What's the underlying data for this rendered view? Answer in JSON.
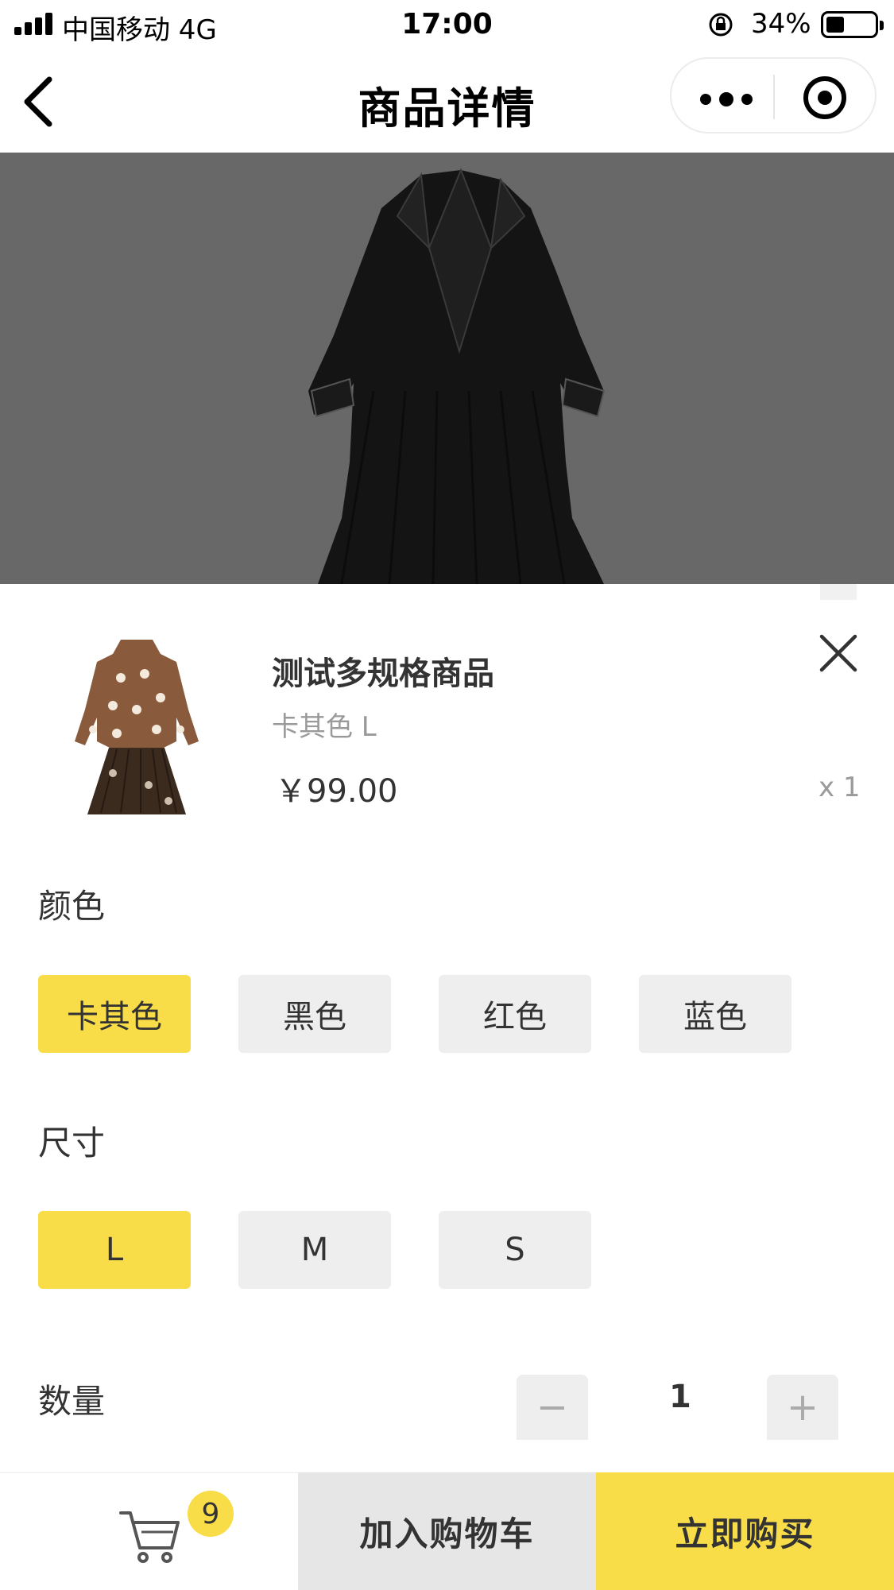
{
  "status_bar": {
    "carrier": "中国移动   4G",
    "time": "17:00",
    "battery_percent": "34%",
    "battery_level": 0.34
  },
  "nav": {
    "title": "商品详情",
    "back_icon": "chevron-left-icon",
    "more_icon": "more-dots-icon",
    "close_icon": "target-circle-icon"
  },
  "product": {
    "name": "测试多规格商品",
    "selected_spec": "卡其色 L",
    "price": "￥99.00",
    "quantity_tag": "x 1"
  },
  "specs": {
    "color_label": "颜色",
    "colors": [
      "卡其色",
      "黑色",
      "红色",
      "蓝色"
    ],
    "selected_color": "卡其色",
    "size_label": "尺寸",
    "sizes": [
      "L",
      "M",
      "S"
    ],
    "selected_size": "L"
  },
  "quantity": {
    "label": "数量",
    "value": "1",
    "decrement": "−",
    "increment": "+"
  },
  "bottom_bar": {
    "cart_badge": "9",
    "add_to_cart": "加入购物车",
    "buy_now": "立即购买"
  },
  "colors": {
    "accent": "#f8dd48",
    "chip_bg": "#eeeeee",
    "overlay": "#686868"
  }
}
